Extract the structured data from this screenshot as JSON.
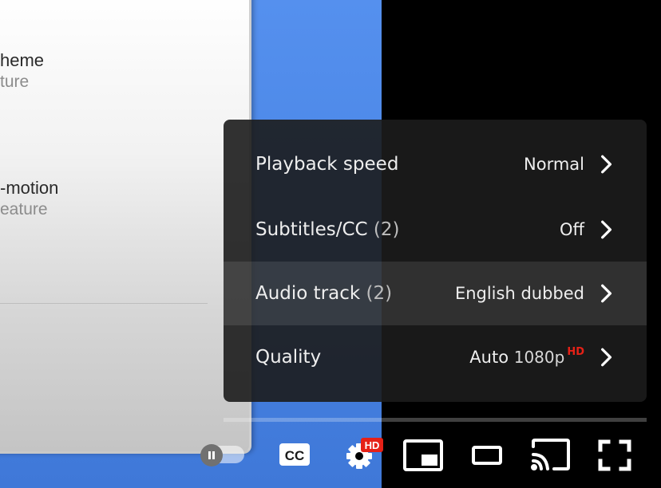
{
  "background_panel": {
    "item1_title": "heme",
    "item1_sub": "ture",
    "item2_title": "-motion",
    "item2_sub": "eature"
  },
  "settings_menu": {
    "items": [
      {
        "label": "Playback speed",
        "count": "",
        "value": "Normal"
      },
      {
        "label": "Subtitles/CC",
        "count": "(2)",
        "value": "Off"
      },
      {
        "label": "Audio track",
        "count": "(2)",
        "value": "English dubbed"
      },
      {
        "label": "Quality",
        "count": "",
        "value": "Auto",
        "resolution": "1080p",
        "badge": "HD"
      }
    ],
    "active_item": "Audio track"
  },
  "controls": {
    "autoplay_state": "on",
    "cc_label": "CC",
    "settings_badge": "HD",
    "icons": [
      "pause-icon",
      "cc-icon",
      "gear-icon",
      "miniplayer-icon",
      "theater-mode-icon",
      "cast-icon",
      "fullscreen-icon"
    ]
  },
  "colors": {
    "accent_red": "#e62117",
    "menu_bg": "#1c1c1c",
    "video_blue": "#4a86e6"
  }
}
